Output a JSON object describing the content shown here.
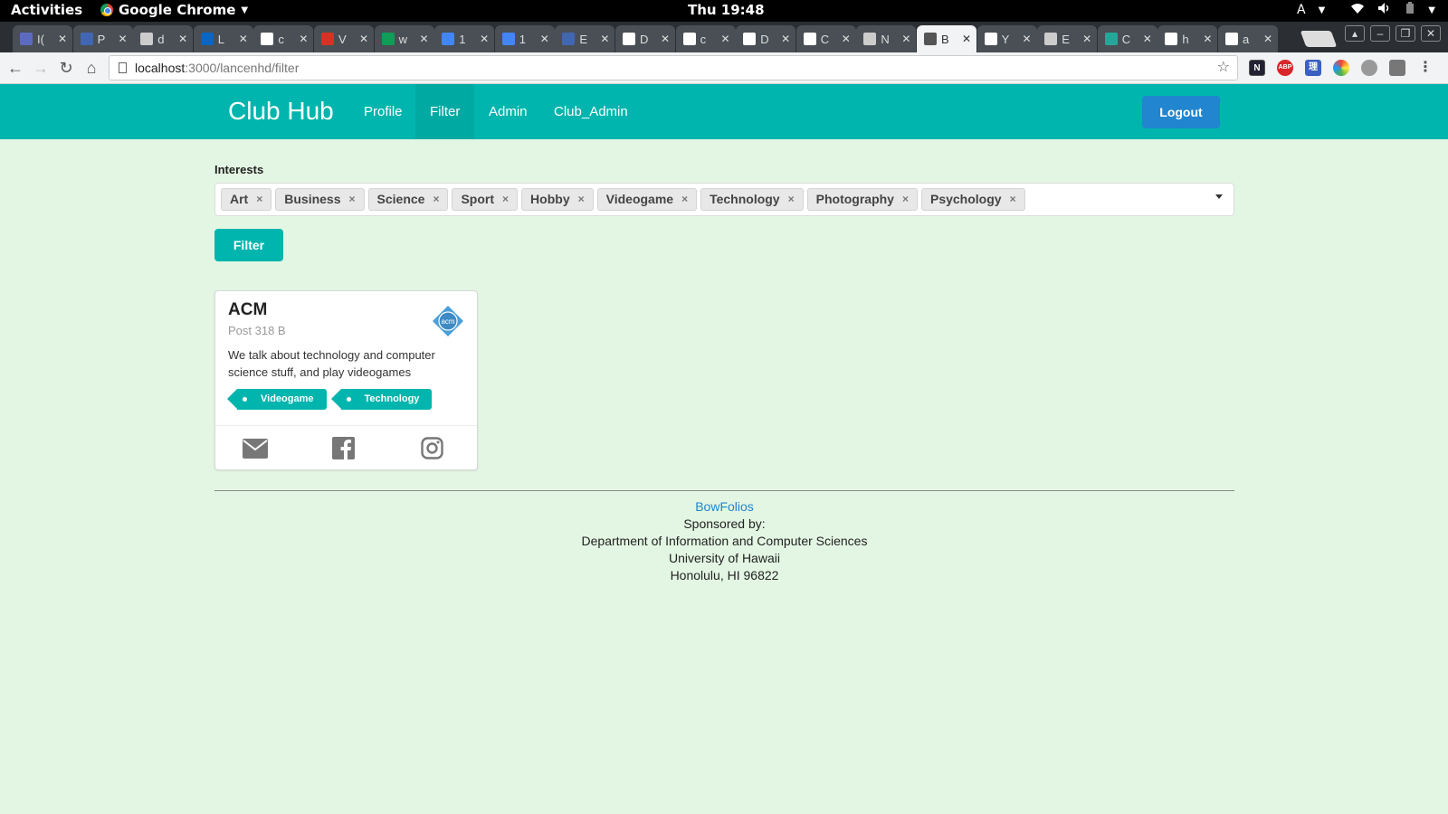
{
  "system_bar": {
    "activities": "Activities",
    "app_name": "Google Chrome",
    "clock": "Thu 19:48",
    "input_indicator": "A"
  },
  "browser": {
    "tabs": [
      {
        "label": "I(",
        "icon": "list-icon",
        "color": "#5c6bc0"
      },
      {
        "label": "P",
        "icon": "square-icon",
        "color": "#4267b2"
      },
      {
        "label": "d",
        "icon": "page-icon",
        "color": "#cccccc"
      },
      {
        "label": "L",
        "icon": "linkedin-icon",
        "color": "#0a66c2"
      },
      {
        "label": "c",
        "icon": "google-icon",
        "color": "#ffffff"
      },
      {
        "label": "V",
        "icon": "gmail-icon",
        "color": "#d93025"
      },
      {
        "label": "w",
        "icon": "drive-icon",
        "color": "#0f9d58"
      },
      {
        "label": "1",
        "icon": "docs-icon",
        "color": "#4285f4"
      },
      {
        "label": "1",
        "icon": "docs-icon",
        "color": "#4285f4"
      },
      {
        "label": "E",
        "icon": "square-icon",
        "color": "#4267b2"
      },
      {
        "label": "D",
        "icon": "github-icon",
        "color": "#ffffff"
      },
      {
        "label": "c",
        "icon": "github-icon",
        "color": "#ffffff"
      },
      {
        "label": "D",
        "icon": "github-icon",
        "color": "#ffffff"
      },
      {
        "label": "C",
        "icon": "github-icon",
        "color": "#ffffff"
      },
      {
        "label": "N",
        "icon": "page-icon",
        "color": "#cccccc"
      },
      {
        "label": "B",
        "icon": "page-icon",
        "color": "#555555",
        "active": true
      },
      {
        "label": "Y",
        "icon": "github-icon",
        "color": "#ffffff"
      },
      {
        "label": "E",
        "icon": "page-icon",
        "color": "#cccccc"
      },
      {
        "label": "C",
        "icon": "s-icon",
        "color": "#26a69a"
      },
      {
        "label": "h",
        "icon": "google-icon",
        "color": "#ffffff"
      },
      {
        "label": "a",
        "icon": "google-icon",
        "color": "#ffffff"
      }
    ],
    "url_host": "localhost",
    "url_path": ":3000/lancenhd/filter"
  },
  "app": {
    "brand": "Club Hub",
    "nav": [
      {
        "label": "Profile"
      },
      {
        "label": "Filter",
        "active": true
      },
      {
        "label": "Admin"
      },
      {
        "label": "Club_Admin"
      }
    ],
    "logout_label": "Logout",
    "accent_color": "#00b5ad",
    "primary_color": "#2185d0"
  },
  "filter_form": {
    "interests_label": "Interests",
    "selected_interests": [
      "Art",
      "Business",
      "Science",
      "Sport",
      "Hobby",
      "Videogame",
      "Technology",
      "Photography",
      "Psychology"
    ],
    "remove_glyph": "×",
    "submit_label": "Filter"
  },
  "club_card": {
    "name": "ACM",
    "location": "Post 318 B",
    "logo_text": "acm",
    "description": "We talk about technology and computer science stuff, and play videogames",
    "tags": [
      "Videogame",
      "Technology"
    ],
    "contact_icons": [
      "email-icon",
      "facebook-icon",
      "instagram-icon"
    ]
  },
  "footer": {
    "link": "BowFolios",
    "line1": "Sponsored by:",
    "line2": "Department of Information and Computer Sciences",
    "line3": "University of Hawaii",
    "line4": "Honolulu, HI 96822"
  }
}
